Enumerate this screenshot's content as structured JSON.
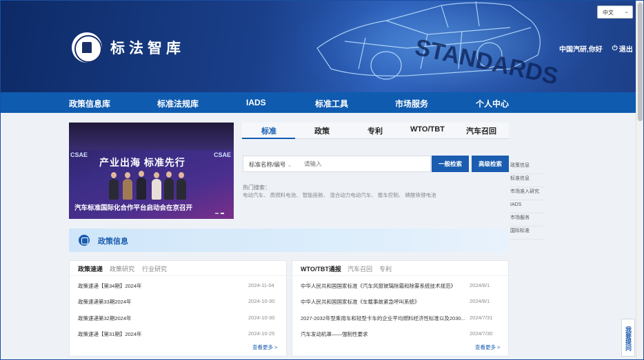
{
  "header": {
    "logo_text": "标法智库",
    "language": "中文",
    "greeting": "中国汽研,你好",
    "logout": "退出",
    "watermark": "STANDARDS"
  },
  "nav": {
    "items": [
      "政策信息库",
      "标准法规库",
      "IADS",
      "标准工具",
      "市场服务",
      "个人中心"
    ]
  },
  "promo": {
    "slogan": "产业出海 标准先行",
    "csae_left": "CSAE",
    "csae_right": "CSAE",
    "caption": "汽车标准国际化合作平台启动会在京召开"
  },
  "search": {
    "tabs": [
      "标准",
      "政策",
      "专利",
      "WTO/TBT",
      "汽车召回"
    ],
    "field_selector": "标准名称/编号",
    "placeholder": "请输入",
    "btn_basic": "一般检索",
    "btn_advanced": "高级检索",
    "hot_label": "热门搜索：",
    "hot_terms": [
      "电动汽车",
      "质燃料电池",
      "智能座舱",
      "混合动力电动汽车",
      "整车控制",
      "磷酸铁锂电池"
    ]
  },
  "side_links": [
    "政策信息",
    "标准信息",
    "市场准入研究",
    "IADS",
    "市场服务",
    "国际标准"
  ],
  "policy_section": {
    "title": "政策信息",
    "left_card": {
      "tabs": [
        "政策速递",
        "政策研究",
        "行业研究"
      ],
      "rows": [
        {
          "title": "政策速递【第34期】2024年",
          "date": "2024-11-04"
        },
        {
          "title": "政策速递第33期2024年",
          "date": "2024-10-30"
        },
        {
          "title": "政策速递第32期2024年",
          "date": "2024-10-30"
        },
        {
          "title": "政策速递【第31期】2024年",
          "date": "2024-10-25"
        }
      ],
      "more": "查看更多 >"
    },
    "right_card": {
      "tabs": [
        "WTO/TBT通报",
        "汽车召回",
        "专利"
      ],
      "rows": [
        {
          "title": "中华人民共和国国家标准《汽车风窗玻璃除霜和除雾系统技术规范》",
          "date": "2024/8/1"
        },
        {
          "title": "中华人民共和国国家标准《车载事故紧急呼叫系统》",
          "date": "2024/8/1"
        },
        {
          "title": "2027-2032年型乘用车和轻型卡车的企业平均燃料经济性标准以及2030...",
          "date": "2024/7/31"
        },
        {
          "title": "汽车发动机罩——强制性要求",
          "date": "2024/7/30"
        }
      ],
      "more": "查看更多 >"
    }
  },
  "feedback": "我要提问",
  "colors": {
    "nav": "#0f5bb0",
    "accent": "#1a5db0",
    "banner": "#1a3f8a"
  }
}
